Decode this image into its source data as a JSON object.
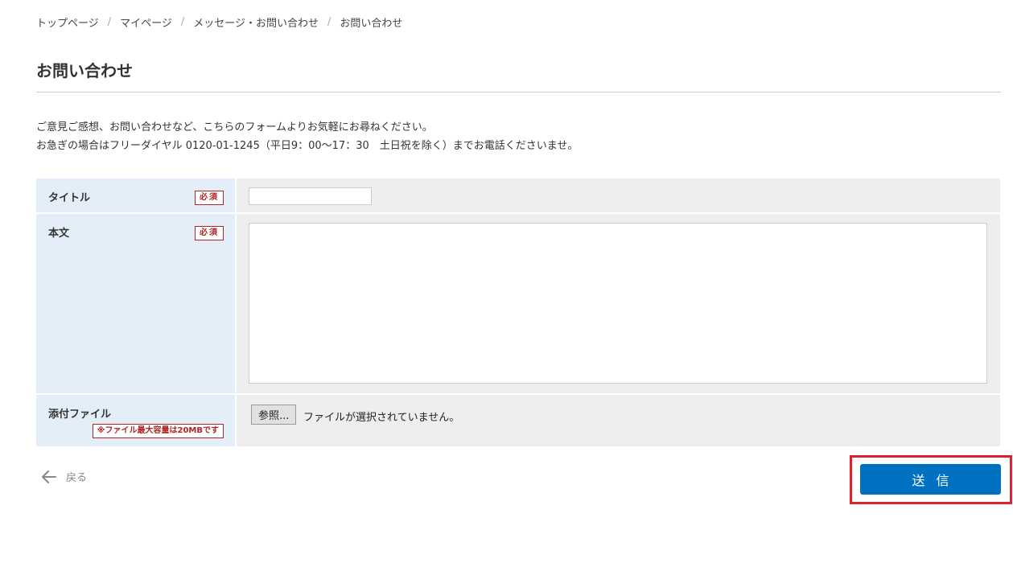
{
  "breadcrumb": {
    "items": [
      "トップページ",
      "マイページ",
      "メッセージ・お問い合わせ",
      "お問い合わせ"
    ],
    "separator": "/"
  },
  "page": {
    "title": "お問い合わせ",
    "intro_line1": "ご意見ご感想、お問い合わせなど、こちらのフォームよりお気軽にお尋ねください。",
    "intro_line2": "お急ぎの場合はフリーダイヤル 0120-01-1245（平日9：00〜17：30　土日祝を除く）までお電話くださいませ。"
  },
  "form": {
    "title_label": "タイトル",
    "title_value": "",
    "body_label": "本文",
    "body_value": "",
    "required_badge": "必須",
    "attachment_label": "添付ファイル",
    "attachment_note": "※ファイル最大容量は20MBです",
    "browse_button": "参照...",
    "file_status": "ファイルが選択されていません。"
  },
  "actions": {
    "back_label": "戻る",
    "submit_label": "送信"
  },
  "colors": {
    "accent": "#0070c0",
    "required": "#b22222",
    "highlight": "#e0202a",
    "label_bg": "#e3eef8",
    "field_bg": "#eeeeee"
  }
}
